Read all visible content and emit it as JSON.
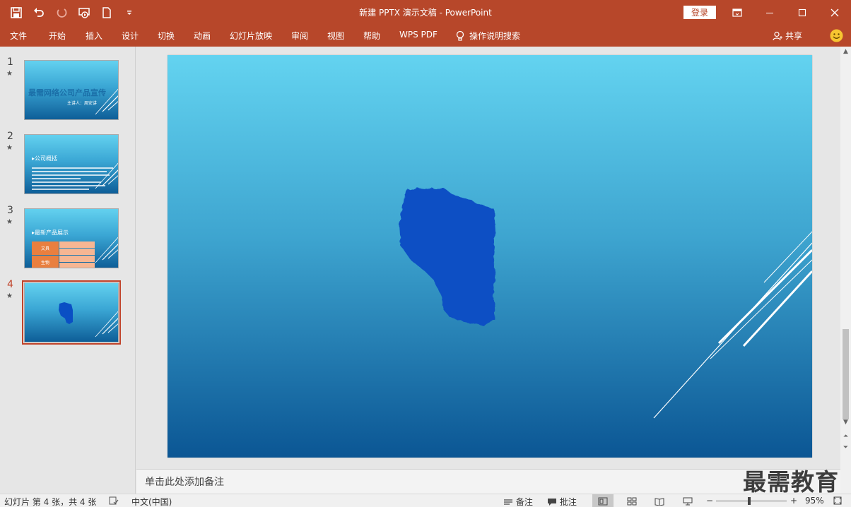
{
  "window": {
    "title": "新建 PPTX 演示文稿  -  PowerPoint",
    "login": "登录"
  },
  "qat_icons": [
    "save-icon",
    "undo-icon",
    "redo-icon",
    "slideshow-from-start-icon",
    "new-file-icon",
    "customize-qat-icon"
  ],
  "tabs": [
    "文件",
    "开始",
    "插入",
    "设计",
    "切换",
    "动画",
    "幻灯片放映",
    "审阅",
    "视图",
    "帮助",
    "WPS PDF"
  ],
  "tell_me": "操作说明搜索",
  "share": "共享",
  "thumbnails": [
    {
      "number": "1",
      "star": "★",
      "title": "最需网络公司产品宣传",
      "subtitle": "主讲人：周安讲"
    },
    {
      "number": "2",
      "star": "★",
      "title": "▸公司概括"
    },
    {
      "number": "3",
      "star": "★",
      "title": "▸最新产品展示",
      "table_headers": [
        "文具",
        "生物"
      ]
    },
    {
      "number": "4",
      "star": "★",
      "active": true
    }
  ],
  "notes_placeholder": "单击此处添加备注",
  "watermark": "最需教育",
  "status": {
    "slide_info": "幻灯片 第 4 张，共 4 张",
    "language": "中文(中国)",
    "notes": "备注",
    "comments": "批注",
    "zoom_minus": "−",
    "zoom_plus": "+",
    "zoom": "95%"
  },
  "colors": {
    "accent": "#b7472a",
    "shape": "#0a4fc4",
    "selection": "#c0432a"
  }
}
